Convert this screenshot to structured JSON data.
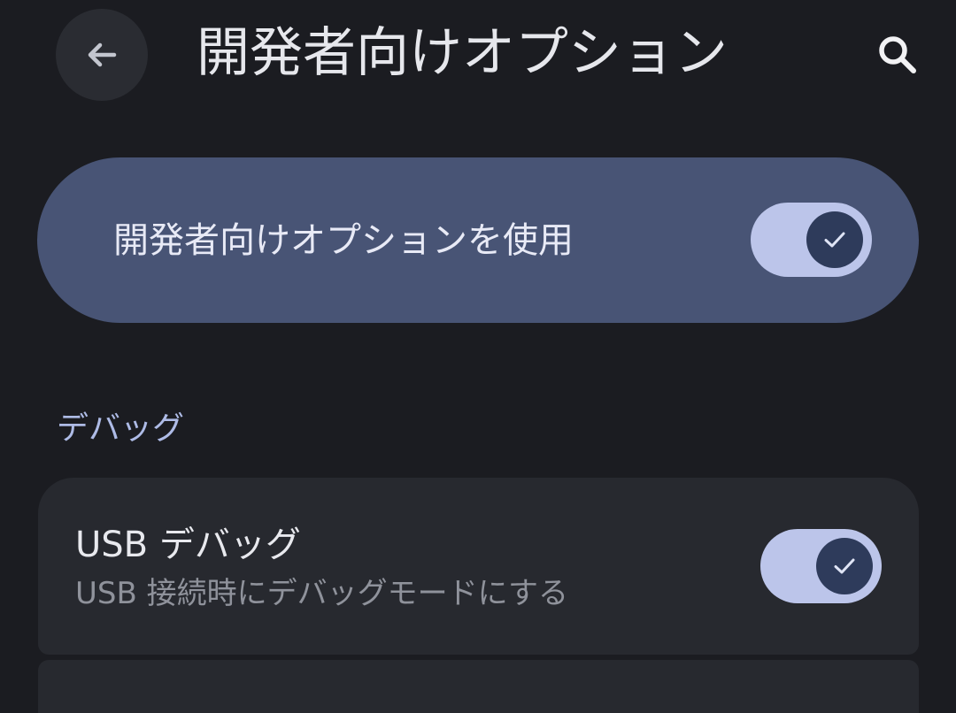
{
  "header": {
    "title": "開発者向けオプション",
    "back_icon": "arrow-back-icon",
    "search_icon": "search-icon"
  },
  "master_switch": {
    "label": "開発者向けオプションを使用",
    "checked": true,
    "check_icon": "check-icon"
  },
  "sections": [
    {
      "header": "デバッグ",
      "items": [
        {
          "title": "USB デバッグ",
          "summary": "USB 接続時にデバッグモードにする",
          "checked": true,
          "check_icon": "check-icon"
        }
      ]
    }
  ],
  "colors": {
    "background": "#1b1c21",
    "master_card": "#485475",
    "setting_card": "#27292f",
    "toggle_track": "#bcc5ea",
    "toggle_thumb": "#2e3b5b",
    "section_header": "#aebbe6"
  }
}
